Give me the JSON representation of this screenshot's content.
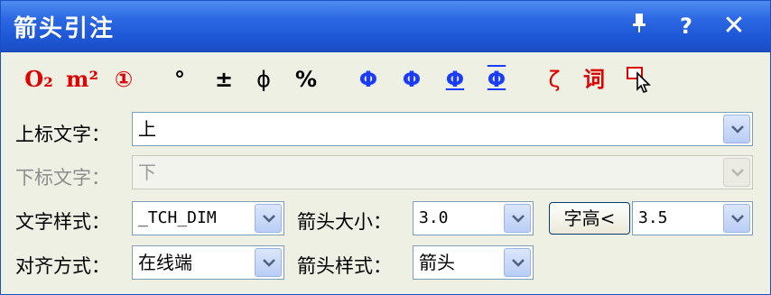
{
  "window": {
    "title": "箭头引注"
  },
  "titlebar": {
    "pin_label": "Ĩ",
    "help_label": "?",
    "close_label": "✕"
  },
  "toolbar": {
    "tools": [
      {
        "label": "O₂",
        "color": "#e00000"
      },
      {
        "label": "m²",
        "color": "#e00000"
      },
      {
        "label": "①",
        "color": "#e00000"
      },
      {
        "label": "°",
        "color": "#000000"
      },
      {
        "label": "±",
        "color": "#000000"
      },
      {
        "label": "ϕ",
        "color": "#000000"
      },
      {
        "label": "%",
        "color": "#000000"
      },
      {
        "label": "Φ",
        "color": "#1a3cff"
      },
      {
        "label": "Φ",
        "color": "#1a3cff"
      },
      {
        "label": "Φ",
        "color": "#1a3cff"
      },
      {
        "label": "Φ",
        "color": "#1a3cff"
      },
      {
        "label": "ζ",
        "color": "#e00000"
      },
      {
        "label": "词",
        "color": "#e00000"
      }
    ]
  },
  "fields": {
    "upper_label": "上标文字：",
    "upper_value": "上",
    "lower_label": "下标文字：",
    "lower_value": "下",
    "text_style_label": "文字样式：",
    "text_style_value": "_TCH_DIM",
    "arrow_size_label": "箭头大小：",
    "arrow_size_value": "3.0",
    "char_height_button": "字高<",
    "char_height_value": "3.5",
    "align_label": "对齐方式：",
    "align_value": "在线端",
    "arrow_style_label": "箭头样式：",
    "arrow_style_value": "箭头"
  }
}
